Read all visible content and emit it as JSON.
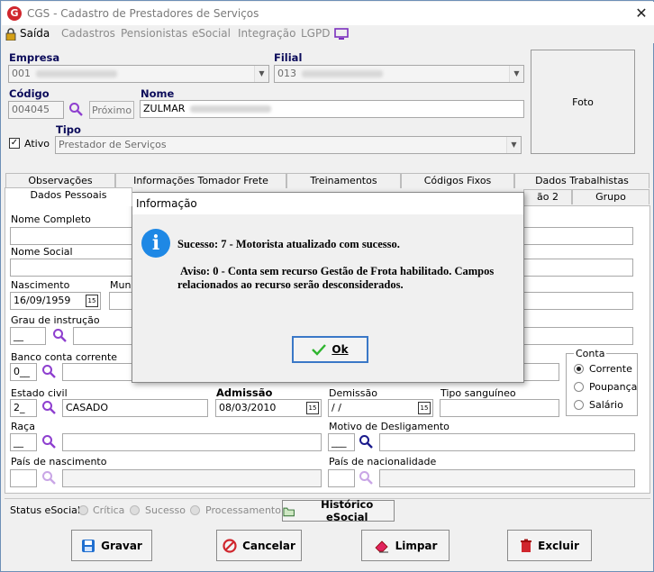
{
  "window": {
    "title": "CGS - Cadastro de Prestadores de Serviços",
    "close": "✕"
  },
  "menu": [
    "Saída",
    "Cadastros",
    "Pensionistas",
    "eSocial",
    "Integração",
    "LGPD"
  ],
  "empresa": {
    "label": "Empresa",
    "value": "001"
  },
  "filial": {
    "label": "Filial",
    "value": "013"
  },
  "codigo": {
    "label": "Código",
    "value": "004045",
    "next": "Próximo"
  },
  "nome": {
    "label": "Nome",
    "value": "ZULMAR"
  },
  "foto": {
    "label": "Foto"
  },
  "ativo": {
    "label": "Ativo",
    "checked": true
  },
  "tipo": {
    "label": "Tipo",
    "value": "Prestador de Serviços"
  },
  "tabs_row1": [
    "Observações",
    "Informações Tomador Frete",
    "Treinamentos",
    "Códigos Fixos",
    "Dados Trabalhistas"
  ],
  "tabs_row2": [
    "Dados Pessoais",
    "ão 2",
    "Grupo"
  ],
  "form": {
    "nome_completo": "Nome Completo",
    "nome_social": "Nome Social",
    "nascimento": {
      "label": "Nascimento",
      "value": "16/09/1959"
    },
    "municipio": "Munic",
    "grau": {
      "label": "Grau de instrução",
      "value": "__"
    },
    "banco": {
      "label": "Banco conta corrente",
      "value": "0__"
    },
    "estado_civil": {
      "label": "Estado civil",
      "code": "2_",
      "value": "CASADO"
    },
    "admissao": {
      "label": "Admissão",
      "value": "08/03/2010"
    },
    "demissao": {
      "label": "Demissão",
      "value": " / /"
    },
    "tipo_sanguineo": "Tipo sanguíneo",
    "raca": {
      "label": "Raça",
      "value": "__"
    },
    "motivo": {
      "label": "Motivo de Desligamento",
      "value": "___"
    },
    "pais_nasc": "País de nascimento",
    "pais_nac": "País de nacionalidade",
    "conta": {
      "label": "Conta",
      "options": [
        "Corrente",
        "Poupança",
        "Salário"
      ],
      "selected": "Corrente"
    }
  },
  "status": {
    "label": "Status eSocial:",
    "options": [
      "Crítica",
      "Sucesso",
      "Processamento"
    ],
    "historico": "Histórico eSocial"
  },
  "buttons": {
    "gravar": "Gravar",
    "cancelar": "Cancelar",
    "limpar": "Limpar",
    "excluir": "Excluir"
  },
  "dialog": {
    "title": "Informação",
    "line1": "Sucesso: 7 - Motorista atualizado com sucesso.",
    "line2": "Aviso: 0 - Conta sem recurso Gestão de Frota habilitado. Campos",
    "line3": "relacionados ao recurso serão desconsiderados.",
    "ok": "Ok"
  },
  "colors": {
    "accent": "#7b2fbe",
    "info": "#1e88e5",
    "danger": "#d0262d"
  }
}
